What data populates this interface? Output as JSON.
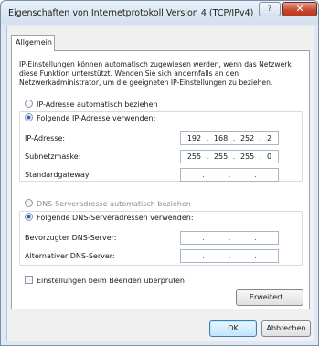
{
  "window": {
    "title": "Eigenschaften von Internetprotokoll Version 4 (TCP/IPv4)",
    "help_label": "?",
    "close_label": "✕"
  },
  "tabs": [
    {
      "label": "Allgemein"
    }
  ],
  "description": "IP-Einstellungen können automatisch zugewiesen werden, wenn das Netzwerk diese Funktion unterstützt. Wenden Sie sich andernfalls an den Netzwerkadministrator, um die geeigneten IP-Einstellungen zu beziehen.",
  "ip": {
    "auto_label": "IP-Adresse automatisch beziehen",
    "manual_label": "Folgende IP-Adresse verwenden:",
    "selected": "manual",
    "fields": [
      {
        "label": "IP-Adresse:",
        "octets": [
          "192",
          "168",
          "252",
          "2"
        ]
      },
      {
        "label": "Subnetzmaske:",
        "octets": [
          "255",
          "255",
          "255",
          "0"
        ]
      },
      {
        "label": "Standardgateway:",
        "octets": [
          "",
          "",
          "",
          ""
        ]
      }
    ]
  },
  "dns": {
    "auto_label": "DNS-Serveradresse automatisch beziehen",
    "manual_label": "Folgende DNS-Serveradressen verwenden:",
    "selected": "manual",
    "fields": [
      {
        "label": "Bevorzugter DNS-Server:",
        "octets": [
          "",
          "",
          "",
          ""
        ]
      },
      {
        "label": "Alternativer DNS-Server:",
        "octets": [
          "",
          "",
          "",
          ""
        ]
      }
    ]
  },
  "validate_label": "Einstellungen beim Beenden überprüfen",
  "buttons": {
    "advanced": "Erweitert...",
    "ok": "OK",
    "cancel": "Abbrechen"
  }
}
